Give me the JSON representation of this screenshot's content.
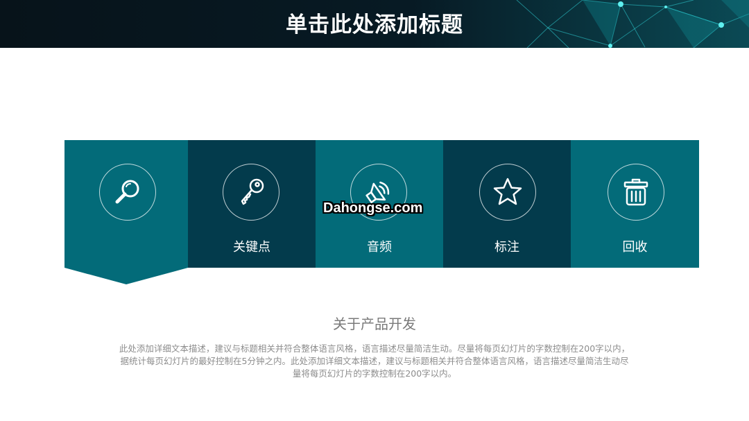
{
  "header": {
    "title": "单击此处添加标题"
  },
  "tiles": [
    {
      "label": "",
      "icon": "magnifier-icon",
      "color": "#036b79"
    },
    {
      "label": "关键点",
      "icon": "key-icon",
      "color": "#033b4c"
    },
    {
      "label": "音频",
      "icon": "speaker-icon",
      "color": "#036b79"
    },
    {
      "label": "标注",
      "icon": "star-icon",
      "color": "#033b4c"
    },
    {
      "label": "回收",
      "icon": "trash-icon",
      "color": "#036b79"
    }
  ],
  "watermark": "Dahongse.com",
  "section": {
    "title": "关于产品开发",
    "body": "此处添加详细文本描述，建议与标题相关并符合整体语言风格，语言描述尽量简洁生动。尽量将每页幻灯片的字数控制在200字以内，据统计每页幻灯片的最好控制在5分钟之内。此处添加详细文本描述，建议与标题相关并符合整体语言风格，语言描述尽量简洁生动尽量将每页幻灯片的字数控制在200字以内。"
  },
  "colors": {
    "header_bg": "#06141c",
    "teal": "#036b79",
    "dark_teal": "#033b4c",
    "text_gray": "#8c8c8c"
  }
}
